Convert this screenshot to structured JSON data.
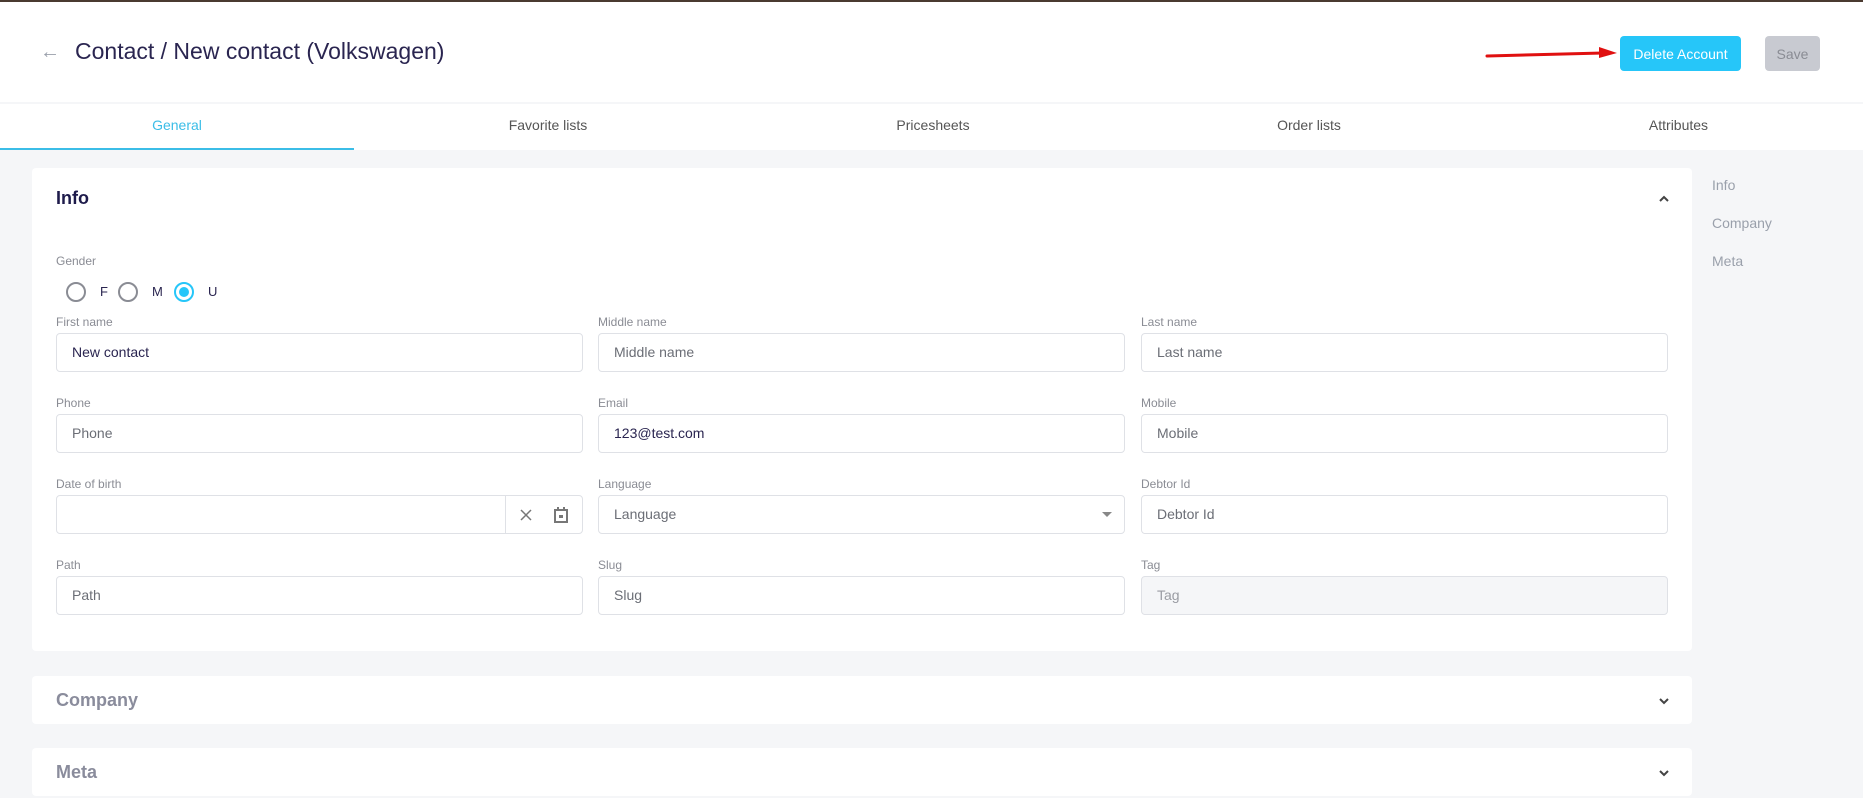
{
  "header": {
    "title": "Contact / New contact (Volkswagen)",
    "delete_label": "Delete Account",
    "save_label": "Save"
  },
  "tabs": [
    {
      "label": "General",
      "active": true
    },
    {
      "label": "Favorite lists"
    },
    {
      "label": "Pricesheets"
    },
    {
      "label": "Order lists"
    },
    {
      "label": "Attributes"
    }
  ],
  "sidenav": [
    "Info",
    "Company",
    "Meta"
  ],
  "info": {
    "title": "Info",
    "gender": {
      "label": "Gender",
      "options": [
        "F",
        "M",
        "U"
      ],
      "selected": "U"
    },
    "fields": {
      "first_name": {
        "label": "First name",
        "value": "New contact"
      },
      "middle_name": {
        "label": "Middle name",
        "placeholder": "Middle name"
      },
      "last_name": {
        "label": "Last name",
        "placeholder": "Last name"
      },
      "phone": {
        "label": "Phone",
        "placeholder": "Phone"
      },
      "email": {
        "label": "Email",
        "value": "123@test.com"
      },
      "mobile": {
        "label": "Mobile",
        "placeholder": "Mobile"
      },
      "dob": {
        "label": "Date of birth",
        "value": ""
      },
      "language": {
        "label": "Language",
        "placeholder": "Language"
      },
      "debtor": {
        "label": "Debtor Id",
        "placeholder": "Debtor Id"
      },
      "path": {
        "label": "Path",
        "placeholder": "Path"
      },
      "slug": {
        "label": "Slug",
        "placeholder": "Slug"
      },
      "tag": {
        "label": "Tag",
        "placeholder": "Tag"
      }
    }
  },
  "company": {
    "title": "Company"
  },
  "meta": {
    "title": "Meta"
  },
  "colors": {
    "accent": "#26c6f9",
    "annotation_arrow": "#e01010"
  }
}
